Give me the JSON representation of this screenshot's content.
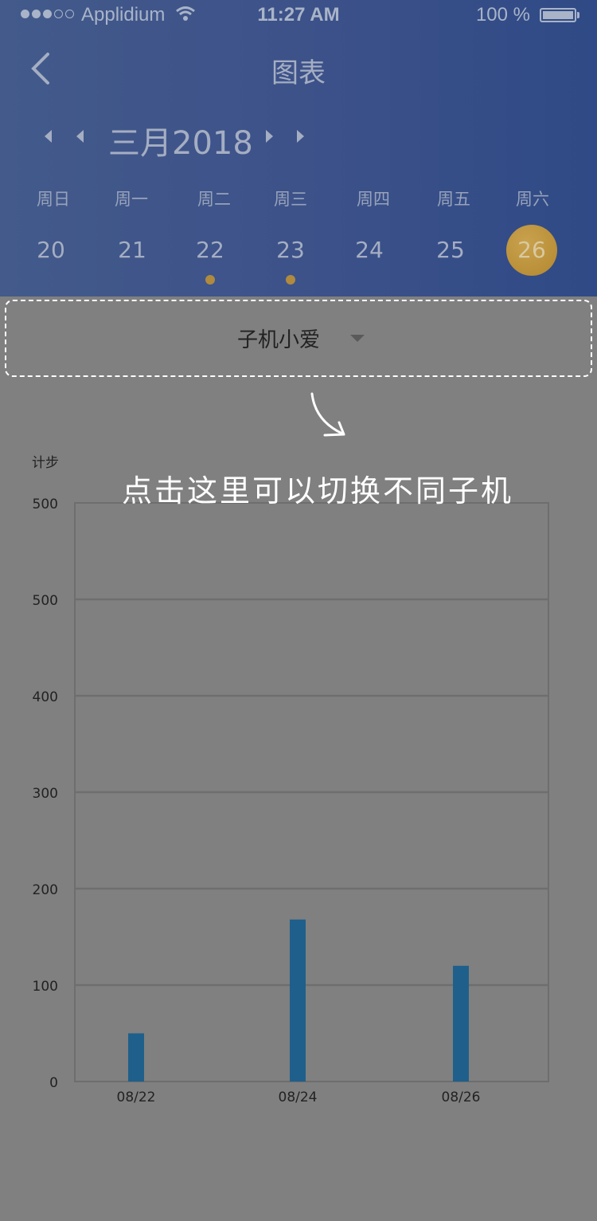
{
  "status_bar": {
    "carrier": "Applidium",
    "time": "11:27 AM",
    "battery": "100 %"
  },
  "nav": {
    "title": "图表",
    "back_icon": "chevron-left-icon"
  },
  "calendar": {
    "month_label": "三月2018",
    "weekdays": [
      "周日",
      "周一",
      "周二",
      "周三",
      "周四",
      "周五",
      "周六"
    ],
    "dates": [
      "20",
      "21",
      "22",
      "23",
      "24",
      "25",
      "26"
    ],
    "selected": "26",
    "dotted": [
      "22",
      "23"
    ]
  },
  "selector": {
    "label": "子机小爱"
  },
  "hint": {
    "text": "点击这里可以切换不同子机"
  },
  "colors": {
    "header": "#3c5189",
    "overlay": "#808080",
    "bar": "#1f5f8b",
    "selected_date": "#b8902f"
  },
  "chart_data": {
    "type": "bar",
    "ylabel": "计步",
    "y_tick_labels": [
      "500",
      "500",
      "400",
      "300",
      "200",
      "100",
      "0"
    ],
    "categories": [
      "08/22",
      "08/24",
      "08/26"
    ],
    "values": [
      50,
      168,
      120
    ],
    "ylim": [
      0,
      600
    ],
    "grid": true
  }
}
